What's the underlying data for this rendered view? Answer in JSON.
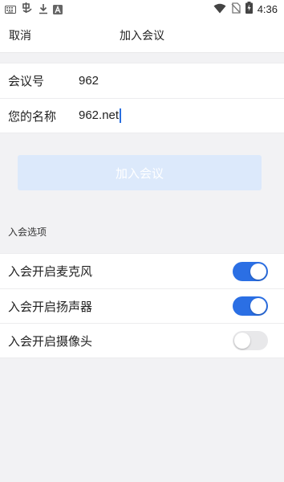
{
  "status_bar": {
    "icons_left": [
      "keyboard-icon",
      "input-method-icon",
      "download-icon",
      "app-notification-icon"
    ],
    "icons_right": [
      "wifi-icon",
      "no-sim-icon",
      "battery-charging-icon"
    ],
    "time": "4:36"
  },
  "nav": {
    "cancel_label": "取消",
    "title": "加入会议"
  },
  "form": {
    "meeting_id_label": "会议号",
    "meeting_id_value": "962",
    "name_label": "您的名称",
    "name_value": "962.net"
  },
  "join_button_label": "加入会议",
  "options": {
    "title": "入会选项",
    "items": [
      {
        "label": "入会开启麦克风",
        "enabled": true
      },
      {
        "label": "入会开启扬声器",
        "enabled": true
      },
      {
        "label": "入会开启摄像头",
        "enabled": false
      }
    ]
  },
  "colors": {
    "accent": "#2b6fe4",
    "join_button_disabled": "#dce9fb",
    "background": "#f2f2f4"
  }
}
